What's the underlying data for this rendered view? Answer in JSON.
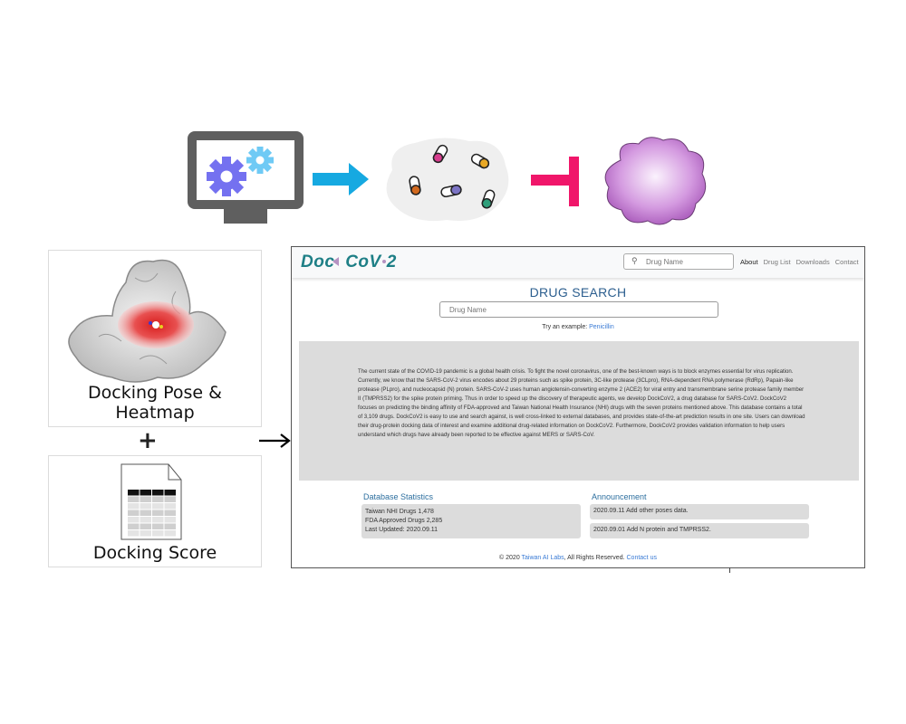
{
  "figure": {
    "top_flow": {
      "computer_icon": "computer-with-gears-icon",
      "arrow_icon": "blue-arrow-icon",
      "drugs_icon": "drug-capsules-cloud-icon",
      "inhibit_icon": "inhibition-t-bar-icon",
      "virus_icon": "virus-blob-icon",
      "colors": {
        "monitor": "#5f5f5f",
        "gear_large": "#7471f0",
        "gear_small": "#6fcaf5",
        "arrow": "#16a9e1",
        "inhibit": "#f0166a",
        "virus": "#b56cc4"
      },
      "capsule_colors": [
        "#d63d8e",
        "#e9a824",
        "#d2691e",
        "#7b73c4",
        "#2e9e7a"
      ]
    },
    "panels": {
      "pose": {
        "caption": "Docking Pose & Heatmap",
        "icon": "protein-heatmap-icon"
      },
      "plus": "+",
      "score": {
        "caption": "Docking Score",
        "icon": "spreadsheet-document-icon"
      },
      "arrow": "right-arrow-icon"
    }
  },
  "website": {
    "logo": {
      "part1": "Doc",
      "part2": "CoV",
      "part3": "2"
    },
    "nav": {
      "search_placeholder": "Drug Name",
      "links": [
        "About",
        "Drug List",
        "Downloads",
        "Contact"
      ]
    },
    "search": {
      "title": "DRUG SEARCH",
      "placeholder": "Drug Name",
      "example_prefix": "Try an example: ",
      "example_link": "Penicillin"
    },
    "about": "The current state of the COVID-19 pandemic is a global health crisis. To fight the novel coronavirus, one of the best-known ways is to block enzymes essential for virus replication. Currently, we know that the SARS-CoV-2 virus encodes about 29 proteins such as spike protein, 3C-like protease (3CLpro), RNA-dependent RNA polymerase (RdRp), Papain-like protease (PLpro), and nucleocapsid (N) protein. SARS-CoV-2 uses human angiotensin-converting enzyme 2 (ACE2) for viral entry and transmembrane serine protease family member II (TMPRSS2) for the spike protein priming. Thus in order to speed up the discovery of therapeutic agents, we develop DockCoV2, a drug database for SARS-CoV2. DockCoV2 focuses on predicting the binding affinity of FDA-approved and Taiwan National Health Insurance (NHI) drugs with the seven proteins mentioned above. This database contains a total of 3,109 drugs. DockCoV2 is easy to use and search against, is well cross-linked to external databases, and provides state-of-the-art prediction results in one site. Users can download their drug-protein docking data of interest and examine additional drug-related information on DockCoV2. Furthermore, DockCoV2 provides validation information to help users understand which drugs have already been reported to be effective against MERS or SARS-CoV.",
    "stats": {
      "title": "Database Statistics",
      "lines": [
        "Taiwan NHI Drugs 1,478",
        "FDA Approved Drugs 2,285",
        "Last Updated: 2020.09.11"
      ]
    },
    "announcement": {
      "title": "Announcement",
      "items": [
        "2020.09.11 Add other poses data.",
        "2020.09.01 Add N protein and TMPRSS2."
      ]
    },
    "footer": {
      "prefix": "© 2020 ",
      "org_link": "Taiwan AI Labs",
      "middle": ", All Rights Reserved. ",
      "contact_link": "Contact us"
    }
  }
}
